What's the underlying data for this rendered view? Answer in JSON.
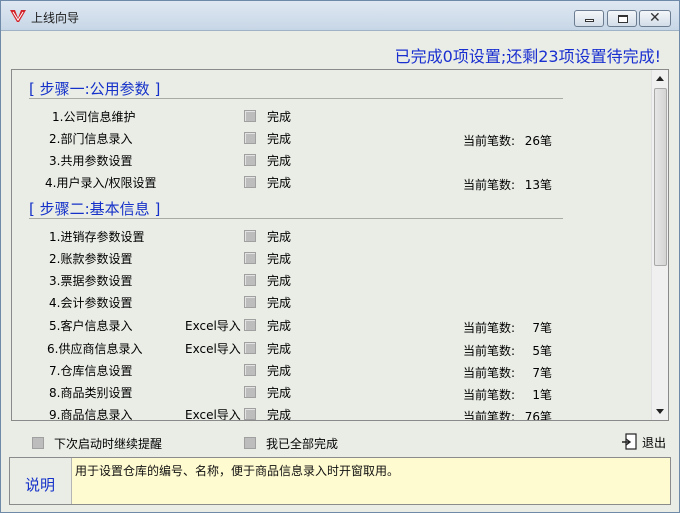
{
  "window": {
    "title": "上线向导"
  },
  "status_text": "已完成0项设置;还剩23项设置待完成!",
  "steps": [
    {
      "title": "[ 步骤一:公用参数 ]",
      "items": [
        {
          "label": "1.公司信息维护",
          "excel": "",
          "done_label": "完成",
          "count_label": "",
          "count_value": ""
        },
        {
          "label": "2.部门信息录入",
          "excel": "",
          "done_label": "完成",
          "count_label": "当前笔数:",
          "count_value": "26笔"
        },
        {
          "label": "3.共用参数设置",
          "excel": "",
          "done_label": "完成",
          "count_label": "",
          "count_value": ""
        },
        {
          "label": "4.用户录入/权限设置",
          "excel": "",
          "done_label": "完成",
          "count_label": "当前笔数:",
          "count_value": "13笔"
        }
      ]
    },
    {
      "title": "[ 步骤二:基本信息 ]",
      "items": [
        {
          "label": "1.进销存参数设置",
          "excel": "",
          "done_label": "完成",
          "count_label": "",
          "count_value": ""
        },
        {
          "label": "2.账款参数设置",
          "excel": "",
          "done_label": "完成",
          "count_label": "",
          "count_value": ""
        },
        {
          "label": "3.票据参数设置",
          "excel": "",
          "done_label": "完成",
          "count_label": "",
          "count_value": ""
        },
        {
          "label": "4.会计参数设置",
          "excel": "",
          "done_label": "完成",
          "count_label": "",
          "count_value": ""
        },
        {
          "label": "5.客户信息录入",
          "excel": "Excel导入",
          "done_label": "完成",
          "count_label": "当前笔数:",
          "count_value": "7笔"
        },
        {
          "label": "6.供应商信息录入",
          "excel": "Excel导入",
          "done_label": "完成",
          "count_label": "当前笔数:",
          "count_value": "5笔"
        },
        {
          "label": "7.仓库信息设置",
          "excel": "",
          "done_label": "完成",
          "count_label": "当前笔数:",
          "count_value": "7笔"
        },
        {
          "label": "8.商品类别设置",
          "excel": "",
          "done_label": "完成",
          "count_label": "当前笔数:",
          "count_value": "1笔"
        },
        {
          "label": "9.商品信息录入",
          "excel": "Excel导入",
          "done_label": "完成",
          "count_label": "当前笔数:",
          "count_value": "76笔"
        }
      ]
    }
  ],
  "bottom": {
    "remind_label": "下次启动时继续提醒",
    "all_done_label": "我已全部完成",
    "exit_label": "退出"
  },
  "description": {
    "label": "说明",
    "text": "用于设置仓库的编号、名称，便于商品信息录入时开窗取用。"
  },
  "colors": {
    "accent_blue": "#1531c9",
    "status_blue": "#1a2fd0",
    "desc_bg": "#fffbd0"
  }
}
